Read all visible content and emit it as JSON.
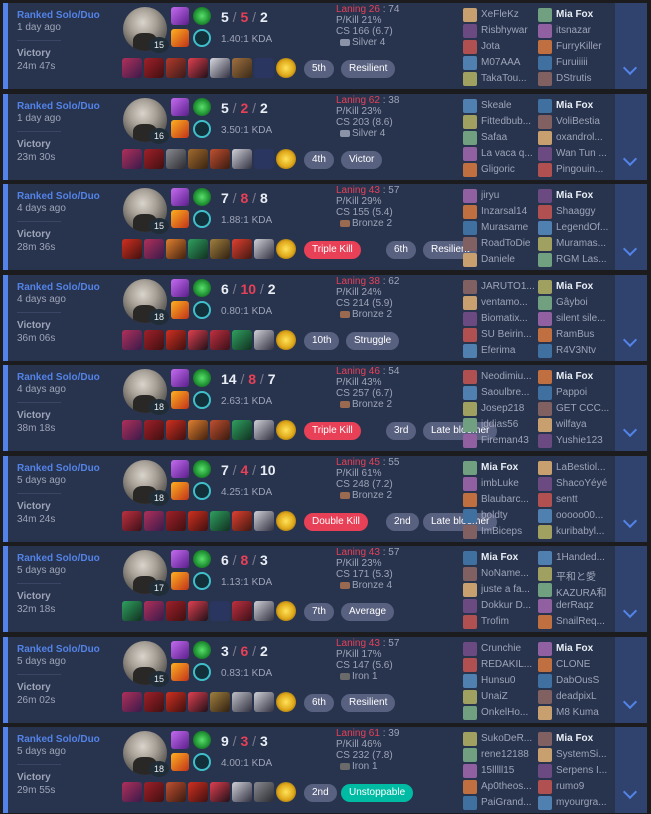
{
  "colors": {
    "accent": "#5383e8",
    "card": "#28344e",
    "loss": "#e84057",
    "tag": "#596180",
    "tag_green": "#00bba3"
  },
  "icons": [
    "summoner-spell-icon",
    "rune-icon",
    "item-icon",
    "ward-icon",
    "expand-chevron-icon",
    "rank-emblem-icon"
  ],
  "matches": [
    {
      "queue": "Ranked Solo/Duo",
      "ago": "1 day ago",
      "result": "Victory",
      "duration": "24m 47s",
      "level": "15",
      "k": "5",
      "d": "5",
      "a": "2",
      "kda": "1.40:1 KDA",
      "laning_label": "Laning 26",
      "laning_opp": " : 74",
      "pkill": "P/Kill 21%",
      "cs": "CS 166 (6.7)",
      "rank": "Silver 4",
      "items": [
        [
          "#b0305a",
          "#3a1a4a"
        ],
        [
          "#a0202a",
          "#401010"
        ],
        [
          "#b23a2a",
          "#3a1a1a"
        ],
        [
          "#e04050",
          "#201018"
        ],
        [
          "#d8d8e0",
          "#303040"
        ],
        [
          "#a07040",
          "#3a2a18"
        ],
        [
          "#2a3560",
          "#2a3560"
        ]
      ],
      "tags": [
        {
          "label": "5th",
          "style": ""
        },
        {
          "label": "Resilient",
          "style": ""
        }
      ],
      "team_a": [
        "XeFleKz",
        "Risbhywar",
        "Jota",
        "M07AAA",
        "TakaTou..."
      ],
      "team_b": [
        "Mia Fox",
        "itsnazar",
        "FurryKiller",
        "Furuiiiii",
        "DStrutis"
      ],
      "me_team": "b",
      "me_index": 0
    },
    {
      "queue": "Ranked Solo/Duo",
      "ago": "1 day ago",
      "result": "Victory",
      "duration": "23m 30s",
      "level": "16",
      "k": "5",
      "d": "2",
      "a": "2",
      "kda": "3.50:1 KDA",
      "laning_label": "Laning 62",
      "laning_opp": " : 38",
      "pkill": "P/Kill 23%",
      "cs": "CS 203 (8.6)",
      "rank": "Silver 4",
      "items": [
        [
          "#b0305a",
          "#3a1a4a"
        ],
        [
          "#a0202a",
          "#401010"
        ],
        [
          "#8a8a92",
          "#2a2a30"
        ],
        [
          "#a06a30",
          "#3a2410"
        ],
        [
          "#c05030",
          "#3a1a10"
        ],
        [
          "#d0d0d8",
          "#303040"
        ],
        [
          "#2a3560",
          "#2a3560"
        ]
      ],
      "tags": [
        {
          "label": "4th",
          "style": ""
        },
        {
          "label": "Victor",
          "style": ""
        }
      ],
      "team_a": [
        "Skeale",
        "Fittedbub...",
        "Safaa",
        "La vaca q...",
        "Gligoric"
      ],
      "team_b": [
        "Mia Fox",
        "VoliBestia",
        "oxandrol...",
        "Wan Tun ...",
        "Pingouin..."
      ],
      "me_team": "b",
      "me_index": 0
    },
    {
      "queue": "Ranked Solo/Duo",
      "ago": "4 days ago",
      "result": "Victory",
      "duration": "28m 36s",
      "level": "15",
      "k": "7",
      "d": "8",
      "a": "8",
      "kda": "1.88:1 KDA",
      "laning_label": "Laning 43",
      "laning_opp": " : 57",
      "pkill": "P/Kill 29%",
      "cs": "CS 155 (5.4)",
      "rank": "Bronze 2",
      "items": [
        [
          "#d03020",
          "#401010"
        ],
        [
          "#b0305a",
          "#3a1a4a"
        ],
        [
          "#e08030",
          "#402010"
        ],
        [
          "#30a060",
          "#103020"
        ],
        [
          "#a08040",
          "#302010"
        ],
        [
          "#e04030",
          "#401810"
        ],
        [
          "#d0d0d8",
          "#303040"
        ]
      ],
      "tags": [
        {
          "label": "Triple Kill",
          "style": "red"
        },
        {
          "label": "6th",
          "style": ""
        },
        {
          "label": "Resilient",
          "style": ""
        }
      ],
      "team_a": [
        "jiryu",
        "Inzarsal14",
        "Murasame",
        "RoadToDie",
        "Daniele"
      ],
      "team_b": [
        "Mia Fox",
        "Shaaggy",
        "LegendOf...",
        "Muramas...",
        "RGM Las..."
      ],
      "me_team": "b",
      "me_index": 0
    },
    {
      "queue": "Ranked Solo/Duo",
      "ago": "4 days ago",
      "result": "Victory",
      "duration": "36m 06s",
      "level": "18",
      "k": "6",
      "d": "10",
      "a": "2",
      "kda": "0.80:1 KDA",
      "laning_label": "Laning 38",
      "laning_opp": " : 62",
      "pkill": "P/Kill 24%",
      "cs": "CS 214 (5.9)",
      "rank": "Bronze 2",
      "items": [
        [
          "#b0305a",
          "#3a1a4a"
        ],
        [
          "#a0202a",
          "#401010"
        ],
        [
          "#d03020",
          "#401010"
        ],
        [
          "#e04050",
          "#201018"
        ],
        [
          "#c03040",
          "#3a1018"
        ],
        [
          "#30a060",
          "#103020"
        ],
        [
          "#d0d0d8",
          "#303040"
        ]
      ],
      "tags": [
        {
          "label": "10th",
          "style": ""
        },
        {
          "label": "Struggle",
          "style": ""
        }
      ],
      "team_a": [
        "JARUTO1...",
        "ventamo...",
        "Biomatix...",
        "SU Beirin...",
        "Eferima"
      ],
      "team_b": [
        "Mia Fox",
        "Gâyboi",
        "silent sile...",
        "RamBus",
        "R4V3Ntv"
      ],
      "me_team": "b",
      "me_index": 0
    },
    {
      "queue": "Ranked Solo/Duo",
      "ago": "4 days ago",
      "result": "Victory",
      "duration": "38m 18s",
      "level": "18",
      "k": "14",
      "d": "8",
      "a": "7",
      "kda": "2.63:1 KDA",
      "laning_label": "Laning 46",
      "laning_opp": " : 54",
      "pkill": "P/Kill 43%",
      "cs": "CS 257 (6.7)",
      "rank": "Bronze 2",
      "items": [
        [
          "#b0305a",
          "#3a1a4a"
        ],
        [
          "#a0202a",
          "#401010"
        ],
        [
          "#d03020",
          "#401010"
        ],
        [
          "#e08030",
          "#402010"
        ],
        [
          "#c05030",
          "#3a1a10"
        ],
        [
          "#30a060",
          "#103020"
        ],
        [
          "#d0d0d8",
          "#303040"
        ]
      ],
      "tags": [
        {
          "label": "Triple Kill",
          "style": "red"
        },
        {
          "label": "3rd",
          "style": ""
        },
        {
          "label": "Late bloomer",
          "style": ""
        }
      ],
      "team_a": [
        "Neodimiu...",
        "Saoulbre...",
        "Josep218",
        "jddias56",
        "Fireman43"
      ],
      "team_b": [
        "Mia Fox",
        "Pappoi",
        "GET CCC...",
        "wilfaya",
        "Yushie123"
      ],
      "me_team": "b",
      "me_index": 0
    },
    {
      "queue": "Ranked Solo/Duo",
      "ago": "5 days ago",
      "result": "Victory",
      "duration": "34m 24s",
      "level": "18",
      "k": "7",
      "d": "4",
      "a": "10",
      "kda": "4.25:1 KDA",
      "laning_label": "Laning 45",
      "laning_opp": " : 55",
      "pkill": "P/Kill 61%",
      "cs": "CS 248 (7.2)",
      "rank": "Bronze 2",
      "items": [
        [
          "#c03040",
          "#3a1018"
        ],
        [
          "#b0305a",
          "#3a1a4a"
        ],
        [
          "#a0202a",
          "#401010"
        ],
        [
          "#d03020",
          "#401010"
        ],
        [
          "#30a060",
          "#103020"
        ],
        [
          "#e04030",
          "#401810"
        ],
        [
          "#d0d0d8",
          "#303040"
        ]
      ],
      "tags": [
        {
          "label": "Double Kill",
          "style": "red"
        },
        {
          "label": "2nd",
          "style": ""
        },
        {
          "label": "Late bloomer",
          "style": ""
        }
      ],
      "team_a": [
        "Mia Fox",
        "imbLuke",
        "Blaubarc...",
        "boldty",
        "ImBiceps"
      ],
      "team_b": [
        "LaBestiol...",
        "ShacoYéyé",
        "sentt",
        "ooooo00...",
        "kuribabyl..."
      ],
      "me_team": "a",
      "me_index": 0
    },
    {
      "queue": "Ranked Solo/Duo",
      "ago": "5 days ago",
      "result": "Victory",
      "duration": "32m 18s",
      "level": "17",
      "k": "6",
      "d": "8",
      "a": "3",
      "kda": "1.13:1 KDA",
      "laning_label": "Laning 43",
      "laning_opp": " : 57",
      "pkill": "P/Kill 23%",
      "cs": "CS 171 (5.3)",
      "rank": "Bronze 4",
      "items": [
        [
          "#30a060",
          "#103020"
        ],
        [
          "#b0305a",
          "#3a1a4a"
        ],
        [
          "#a0202a",
          "#401010"
        ],
        [
          "#e04050",
          "#201018"
        ],
        [
          "#2a3560",
          "#2a3560"
        ],
        [
          "#c03040",
          "#3a1018"
        ],
        [
          "#d0d0d8",
          "#303040"
        ]
      ],
      "tags": [
        {
          "label": "7th",
          "style": ""
        },
        {
          "label": "Average",
          "style": ""
        }
      ],
      "team_a": [
        "Mia Fox",
        "NoName...",
        "juste a fa...",
        "Dokkur D...",
        "Trofim"
      ],
      "team_b": [
        "1Handed...",
        "平和と愛",
        "KAZURA和",
        "derRaqz",
        "SnailReq..."
      ],
      "me_team": "a",
      "me_index": 0
    },
    {
      "queue": "Ranked Solo/Duo",
      "ago": "5 days ago",
      "result": "Victory",
      "duration": "26m 02s",
      "level": "15",
      "k": "3",
      "d": "6",
      "a": "2",
      "kda": "0.83:1 KDA",
      "laning_label": "Laning 43",
      "laning_opp": " : 57",
      "pkill": "P/Kill 17%",
      "cs": "CS 147 (5.6)",
      "rank": "Iron 1",
      "items": [
        [
          "#b0305a",
          "#3a1a4a"
        ],
        [
          "#a0202a",
          "#401010"
        ],
        [
          "#d03020",
          "#401010"
        ],
        [
          "#e04050",
          "#201018"
        ],
        [
          "#a08040",
          "#302010"
        ],
        [
          "#c0c0c8",
          "#303040"
        ],
        [
          "#d0d0d8",
          "#303040"
        ]
      ],
      "tags": [
        {
          "label": "6th",
          "style": ""
        },
        {
          "label": "Resilient",
          "style": ""
        }
      ],
      "team_a": [
        "Crunchie",
        "REDAKIL...",
        "Hunsu0",
        "UnaiZ",
        "OnkelHo..."
      ],
      "team_b": [
        "Mia Fox",
        "CLONE",
        "DabOusS",
        "deadpixL",
        "M8 Kuma"
      ],
      "me_team": "b",
      "me_index": 0
    },
    {
      "queue": "Ranked Solo/Duo",
      "ago": "5 days ago",
      "result": "Victory",
      "duration": "29m 55s",
      "level": "18",
      "k": "9",
      "d": "3",
      "a": "3",
      "kda": "4.00:1 KDA",
      "laning_label": "Laning 61",
      "laning_opp": " : 39",
      "pkill": "P/Kill 46%",
      "cs": "CS 232 (7.8)",
      "rank": "Iron 1",
      "items": [
        [
          "#b0305a",
          "#3a1a4a"
        ],
        [
          "#a0202a",
          "#401010"
        ],
        [
          "#c05030",
          "#3a1a10"
        ],
        [
          "#d03020",
          "#401010"
        ],
        [
          "#e04050",
          "#201018"
        ],
        [
          "#d0d0d8",
          "#303040"
        ],
        [
          "#8a8a92",
          "#2a2a30"
        ]
      ],
      "tags": [
        {
          "label": "2nd",
          "style": ""
        },
        {
          "label": "Unstoppable",
          "style": "green"
        }
      ],
      "team_a": [
        "SukoDeR...",
        "rene12188",
        "15lllll15",
        "Ap0theos...",
        "PaiGrand..."
      ],
      "team_b": [
        "Mia Fox",
        "SystemSi...",
        "Serpens I...",
        "rumo9",
        "myourgra..."
      ],
      "me_team": "b",
      "me_index": 0
    }
  ]
}
